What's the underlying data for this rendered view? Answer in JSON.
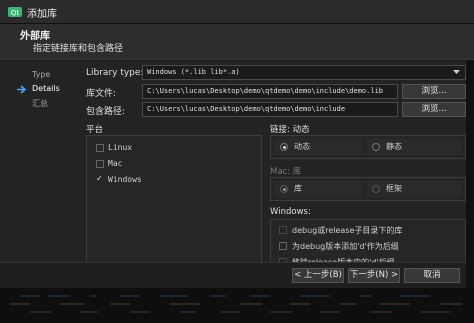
{
  "window": {
    "title": "添加库"
  },
  "header": {
    "title": "外部库",
    "subtitle": "指定链接库和包含路径"
  },
  "sidebar": {
    "items": [
      "Type",
      "Details",
      "汇总"
    ]
  },
  "form": {
    "library_type_label": "Library type:",
    "library_type_value": "Windows (*.lib lib*.a)",
    "library_file_label": "库文件:",
    "library_file_value": "C:\\Users\\lucas\\Desktop\\demo\\qtdemo\\demo\\include\\demo.lib",
    "include_path_label": "包含路径:",
    "include_path_value": "C:\\Users\\lucas\\Desktop\\demo\\qtdemo\\demo\\include",
    "browse_label": "浏览..."
  },
  "platform": {
    "title": "平台",
    "items": [
      "Linux",
      "Mac",
      "Windows"
    ],
    "checked": [
      false,
      false,
      true
    ]
  },
  "linking": {
    "title": "链接: 动态",
    "options": [
      "动态",
      "静态"
    ],
    "selected": "动态"
  },
  "mac": {
    "title": "Mac: 库",
    "options": [
      "库",
      "框架"
    ],
    "selected": "库"
  },
  "windows": {
    "title": "Windows:",
    "options": [
      "debug或release子目录下的库",
      "为debug版本添加'd'作为后缀",
      "移除release版本中的'd'后缀"
    ]
  },
  "footer": {
    "back": "< 上一步(B)",
    "next": "下一步(N) >",
    "cancel": "取消"
  },
  "colors": {
    "accent": "#4aa3ff",
    "icon_green": "#3cb371"
  }
}
